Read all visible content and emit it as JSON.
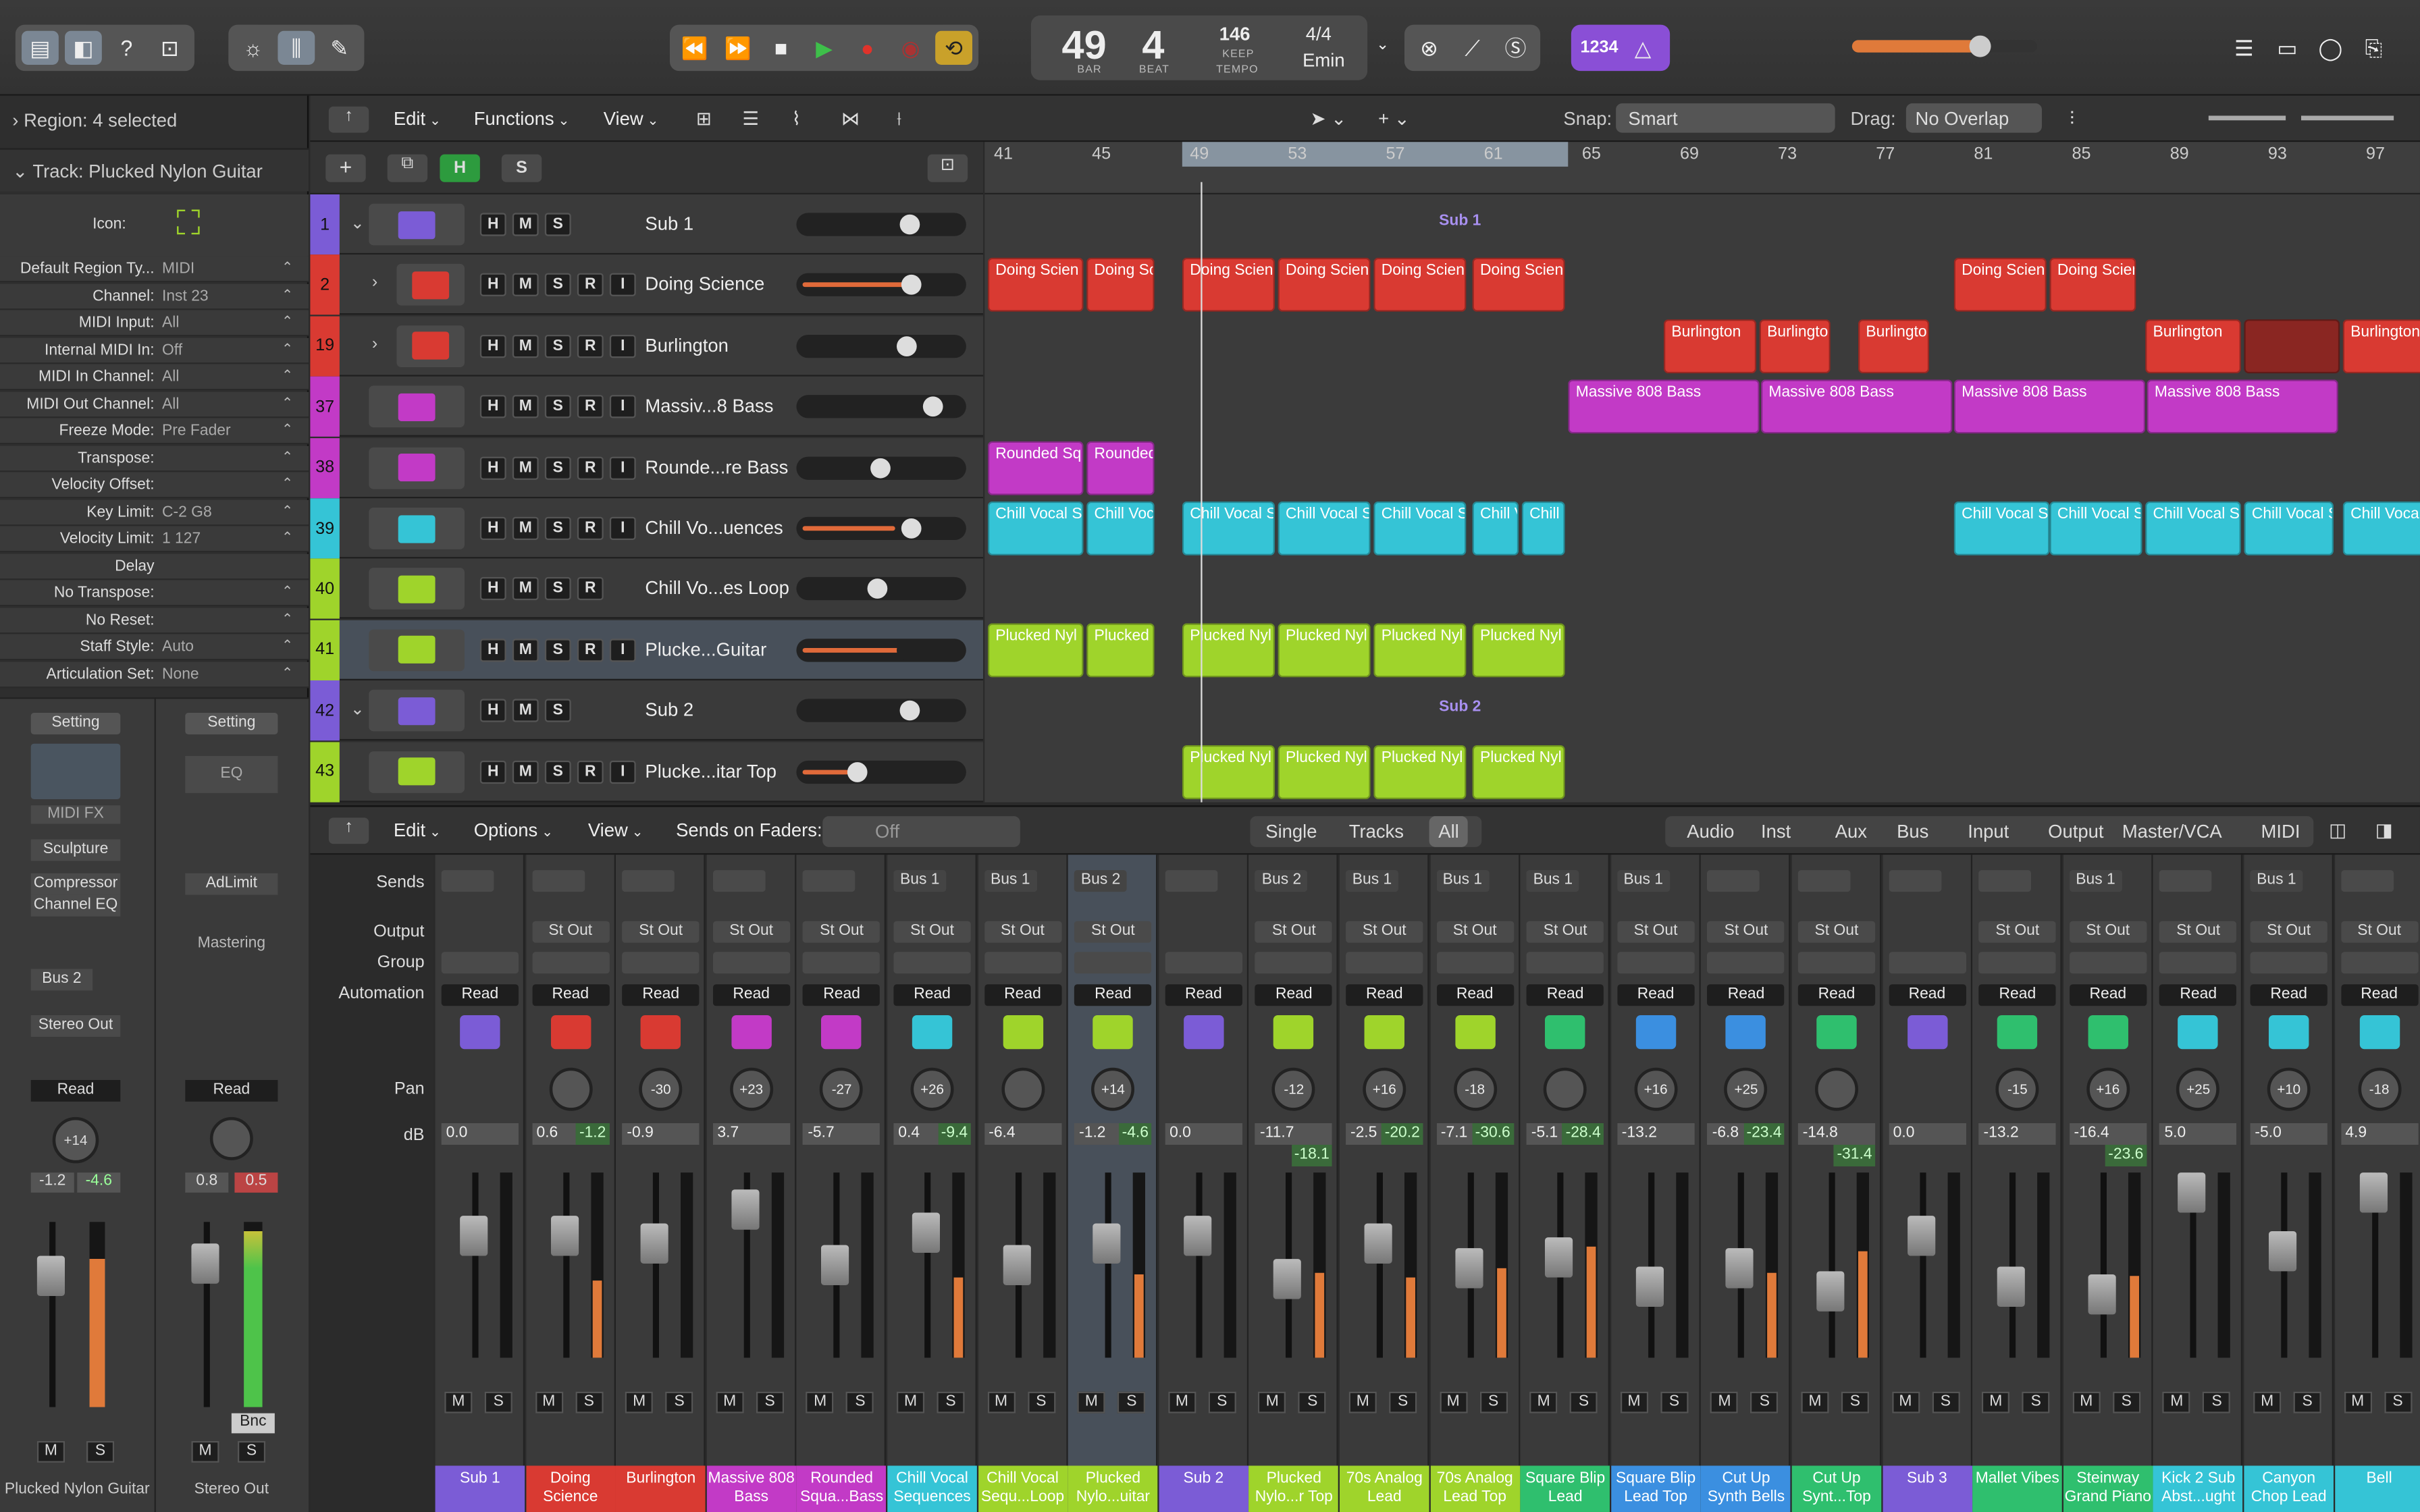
{
  "transport": {
    "bar": "49",
    "beat": "4",
    "bar_label": "BAR",
    "beat_label": "BEAT",
    "tempo": "146",
    "tempo_mode": "KEEP",
    "tempo_label": "TEMPO",
    "sig": "4/4",
    "key": "Emin",
    "count_in": "1234"
  },
  "inspector": {
    "region": "Region: 4 selected",
    "track": "Track:  Plucked Nylon Guitar",
    "icon_label": "Icon:",
    "rows": [
      {
        "k": "Default Region Ty...",
        "v": "MIDI"
      },
      {
        "k": "Channel:",
        "v": "Inst 23"
      },
      {
        "k": "MIDI Input:",
        "v": "All"
      },
      {
        "k": "Internal MIDI In:",
        "v": "Off"
      },
      {
        "k": "MIDI In Channel:",
        "v": "All"
      },
      {
        "k": "MIDI Out Channel:",
        "v": "All"
      },
      {
        "k": "Freeze Mode:",
        "v": "Pre Fader"
      },
      {
        "k": "Transpose:",
        "v": ""
      },
      {
        "k": "Velocity Offset:",
        "v": ""
      },
      {
        "k": "Key Limit:",
        "v": "C-2  G8"
      },
      {
        "k": "Velocity Limit:",
        "v": "1  127"
      },
      {
        "k": "Delay",
        "v": ""
      },
      {
        "k": "No Transpose:",
        "v": ""
      },
      {
        "k": "No Reset:",
        "v": ""
      },
      {
        "k": "Staff Style:",
        "v": "Auto"
      },
      {
        "k": "Articulation Set:",
        "v": "None"
      }
    ],
    "strip1": {
      "setting": "Setting",
      "midifx": "MIDI FX",
      "sculpture": "Sculpture",
      "comp": "Compressor",
      "eq": "Channel EQ",
      "bus": "Bus 2",
      "out": "Stereo Out",
      "read": "Read",
      "pan": "+14",
      "db1": "-1.2",
      "db2": "-4.6",
      "m": "M",
      "s": "S",
      "name": "Plucked Nylon Guitar"
    },
    "strip2": {
      "setting": "Setting",
      "eq": "EQ",
      "adlimit": "AdLimit",
      "mastering": "Mastering",
      "read": "Read",
      "db1": "0.8",
      "db2": "0.5",
      "bnc": "Bnc",
      "m": "M",
      "s": "S",
      "name": "Stereo Out"
    }
  },
  "tracks_toolbar": {
    "edit": "Edit",
    "functions": "Functions",
    "view": "View",
    "snap_label": "Snap:",
    "snap": "Smart",
    "drag_label": "Drag:",
    "drag": "No Overlap"
  },
  "ruler": [
    "41",
    "45",
    "49",
    "53",
    "57",
    "61",
    "65",
    "69",
    "73",
    "77",
    "81",
    "85",
    "89",
    "93",
    "97"
  ],
  "tracks": [
    {
      "n": "1",
      "name": "Sub 1",
      "color": "#7b5cd6",
      "btns": [
        "H",
        "M",
        "S"
      ],
      "vol": 0.7,
      "lvl": 0,
      "folder": true
    },
    {
      "n": "2",
      "name": "Doing Science",
      "color": "#d93a32",
      "btns": [
        "H",
        "M",
        "S",
        "R",
        "I"
      ],
      "vol": 0.72,
      "lvl": 0.7,
      "disc": true
    },
    {
      "n": "19",
      "name": "Burlington",
      "color": "#d93a32",
      "btns": [
        "H",
        "M",
        "S",
        "R",
        "I"
      ],
      "vol": 0.68,
      "lvl": 0,
      "disc": true
    },
    {
      "n": "37",
      "name": "Massiv...8 Bass",
      "color": "#c23ac6",
      "btns": [
        "H",
        "M",
        "S",
        "R",
        "I"
      ],
      "vol": 0.86,
      "lvl": 0
    },
    {
      "n": "38",
      "name": "Rounde...re Bass",
      "color": "#c23ac6",
      "btns": [
        "H",
        "M",
        "S",
        "R",
        "I"
      ],
      "vol": 0.5,
      "lvl": 0
    },
    {
      "n": "39",
      "name": "Chill Vo...uences",
      "color": "#35c4d6",
      "btns": [
        "H",
        "M",
        "S",
        "R",
        "I"
      ],
      "vol": 0.72,
      "lvl": 0.6
    },
    {
      "n": "40",
      "name": "Chill Vo...es Loop",
      "color": "#9fd42b",
      "btns": [
        "H",
        "M",
        "S",
        "R"
      ],
      "vol": 0.48,
      "lvl": 0
    },
    {
      "n": "41",
      "name": "Plucke...Guitar",
      "color": "#9fd42b",
      "btns": [
        "H",
        "M",
        "S",
        "R",
        "I"
      ],
      "vol": 0.68,
      "lvl": 0.65,
      "sel": true
    },
    {
      "n": "42",
      "name": "Sub 2",
      "color": "#7b5cd6",
      "btns": [
        "H",
        "M",
        "S"
      ],
      "vol": 0.7,
      "lvl": 0,
      "folder": true
    },
    {
      "n": "43",
      "name": "Plucke...itar Top",
      "color": "#9fd42b",
      "btns": [
        "H",
        "M",
        "S",
        "R",
        "I"
      ],
      "vol": 0.35,
      "lvl": 0.3
    }
  ],
  "regions": [
    {
      "row": 0,
      "x": 0.28,
      "w": 0,
      "label": "Sub 1",
      "type": "folder"
    },
    {
      "row": 0,
      "x": 0.28,
      "w": 0,
      "label": "",
      "type": "none"
    }
  ],
  "mixer": {
    "edit": "Edit",
    "options": "Options",
    "view": "View",
    "sends_on": "Sends on Faders:",
    "off": "Off",
    "single": "Single",
    "tracks": "Tracks",
    "all": "All",
    "filters": [
      "Audio",
      "Inst",
      "Aux",
      "Bus",
      "Input",
      "Output",
      "Master/VCA",
      "MIDI"
    ],
    "labels": {
      "sends": "Sends",
      "output": "Output",
      "group": "Group",
      "automation": "Automation",
      "pan": "Pan",
      "db": "dB"
    },
    "strips": [
      {
        "name": "Sub 1",
        "color": "#7b5cd6",
        "send": "",
        "out": "",
        "pan": "",
        "db": "0.0",
        "db2": "",
        "f": 0.3
      },
      {
        "name": "Doing Science",
        "color": "#d93a32",
        "send": "",
        "out": "St Out",
        "pan": "",
        "db": "0.6",
        "db2": "-1.2",
        "f": 0.3
      },
      {
        "name": "Burlington",
        "color": "#d93a32",
        "send": "",
        "out": "St Out",
        "pan": "-30",
        "db": "-0.9",
        "db2": "",
        "f": 0.35
      },
      {
        "name": "Massive 808 Bass",
        "color": "#c23ac6",
        "send": "",
        "out": "St Out",
        "pan": "+23",
        "db": "3.7",
        "db2": "",
        "f": 0.12
      },
      {
        "name": "Rounded Squa...Bass",
        "color": "#c23ac6",
        "send": "",
        "out": "St Out",
        "pan": "-27",
        "db": "-5.7",
        "db2": "",
        "f": 0.5
      },
      {
        "name": "Chill Vocal Sequences",
        "color": "#35c4d6",
        "send": "Bus 1",
        "out": "St Out",
        "pan": "+26",
        "db": "0.4",
        "db2": "-9.4",
        "f": 0.28
      },
      {
        "name": "Chill Vocal Sequ...Loop",
        "color": "#9fd42b",
        "send": "Bus 1",
        "out": "St Out",
        "pan": "",
        "db": "-6.4",
        "db2": "",
        "f": 0.5
      },
      {
        "name": "Plucked Nylo...uitar",
        "color": "#9fd42b",
        "send": "Bus 2",
        "out": "St Out",
        "pan": "+14",
        "db": "-1.2",
        "db2": "-4.6",
        "f": 0.35,
        "sel": true
      },
      {
        "name": "Sub 2",
        "color": "#7b5cd6",
        "send": "",
        "out": "",
        "pan": "",
        "db": "0.0",
        "db2": "",
        "f": 0.3
      },
      {
        "name": "Plucked Nylo...r Top",
        "color": "#9fd42b",
        "send": "Bus 2",
        "out": "St Out",
        "pan": "-12",
        "db": "-11.7",
        "db2": "-18.1",
        "f": 0.6
      },
      {
        "name": "70s Analog Lead",
        "color": "#9fd42b",
        "send": "Bus 1",
        "out": "St Out",
        "pan": "+16",
        "db": "-2.5",
        "db2": "-20.2",
        "f": 0.35
      },
      {
        "name": "70s Analog Lead Top",
        "color": "#9fd42b",
        "send": "Bus 1",
        "out": "St Out",
        "pan": "-18",
        "db": "-7.1",
        "db2": "-30.6",
        "f": 0.52
      },
      {
        "name": "Square Blip Lead",
        "color": "#2fbf6e",
        "send": "Bus 1",
        "out": "St Out",
        "pan": "",
        "db": "-5.1",
        "db2": "-28.4",
        "f": 0.45
      },
      {
        "name": "Square Blip Lead Top",
        "color": "#3b8fe0",
        "send": "Bus 1",
        "out": "St Out",
        "pan": "+16",
        "db": "-13.2",
        "db2": "",
        "f": 0.65
      },
      {
        "name": "Cut Up Synth Bells",
        "color": "#3b8fe0",
        "send": "",
        "out": "St Out",
        "pan": "+25",
        "db": "-6.8",
        "db2": "-23.4",
        "f": 0.52
      },
      {
        "name": "Cut Up Synt...Top",
        "color": "#2fbf6e",
        "send": "",
        "out": "St Out",
        "pan": "",
        "db": "-14.8",
        "db2": "-31.4",
        "f": 0.68
      },
      {
        "name": "Sub 3",
        "color": "#7b5cd6",
        "send": "",
        "out": "",
        "pan": "",
        "db": "0.0",
        "db2": "",
        "f": 0.3
      },
      {
        "name": "Mallet Vibes",
        "color": "#2fbf6e",
        "send": "",
        "out": "St Out",
        "pan": "-15",
        "db": "-13.2",
        "db2": "",
        "f": 0.65
      },
      {
        "name": "Steinway Grand Piano",
        "color": "#2fbf6e",
        "send": "Bus 1",
        "out": "St Out",
        "pan": "+16",
        "db": "-16.4",
        "db2": "-23.6",
        "f": 0.7
      },
      {
        "name": "Kick 2 Sub Abst...ught",
        "color": "#35c4d6",
        "send": "",
        "out": "St Out",
        "pan": "+25",
        "db": "5.0",
        "db2": "",
        "f": 0.0
      },
      {
        "name": "Canyon Chop Lead",
        "color": "#35c4d6",
        "send": "Bus 1",
        "out": "St Out",
        "pan": "+10",
        "db": "-5.0",
        "db2": "",
        "f": 0.4
      },
      {
        "name": "Bell",
        "color": "#35c4d6",
        "send": "",
        "out": "St Out",
        "pan": "-18",
        "db": "4.9",
        "db2": "",
        "f": 0.0
      }
    ]
  },
  "colors": {
    "red": "#d93a32",
    "purple": "#c23ac6",
    "cyan": "#35c4d6",
    "green": "#9fd42b",
    "folder": "#7b5cd6"
  }
}
